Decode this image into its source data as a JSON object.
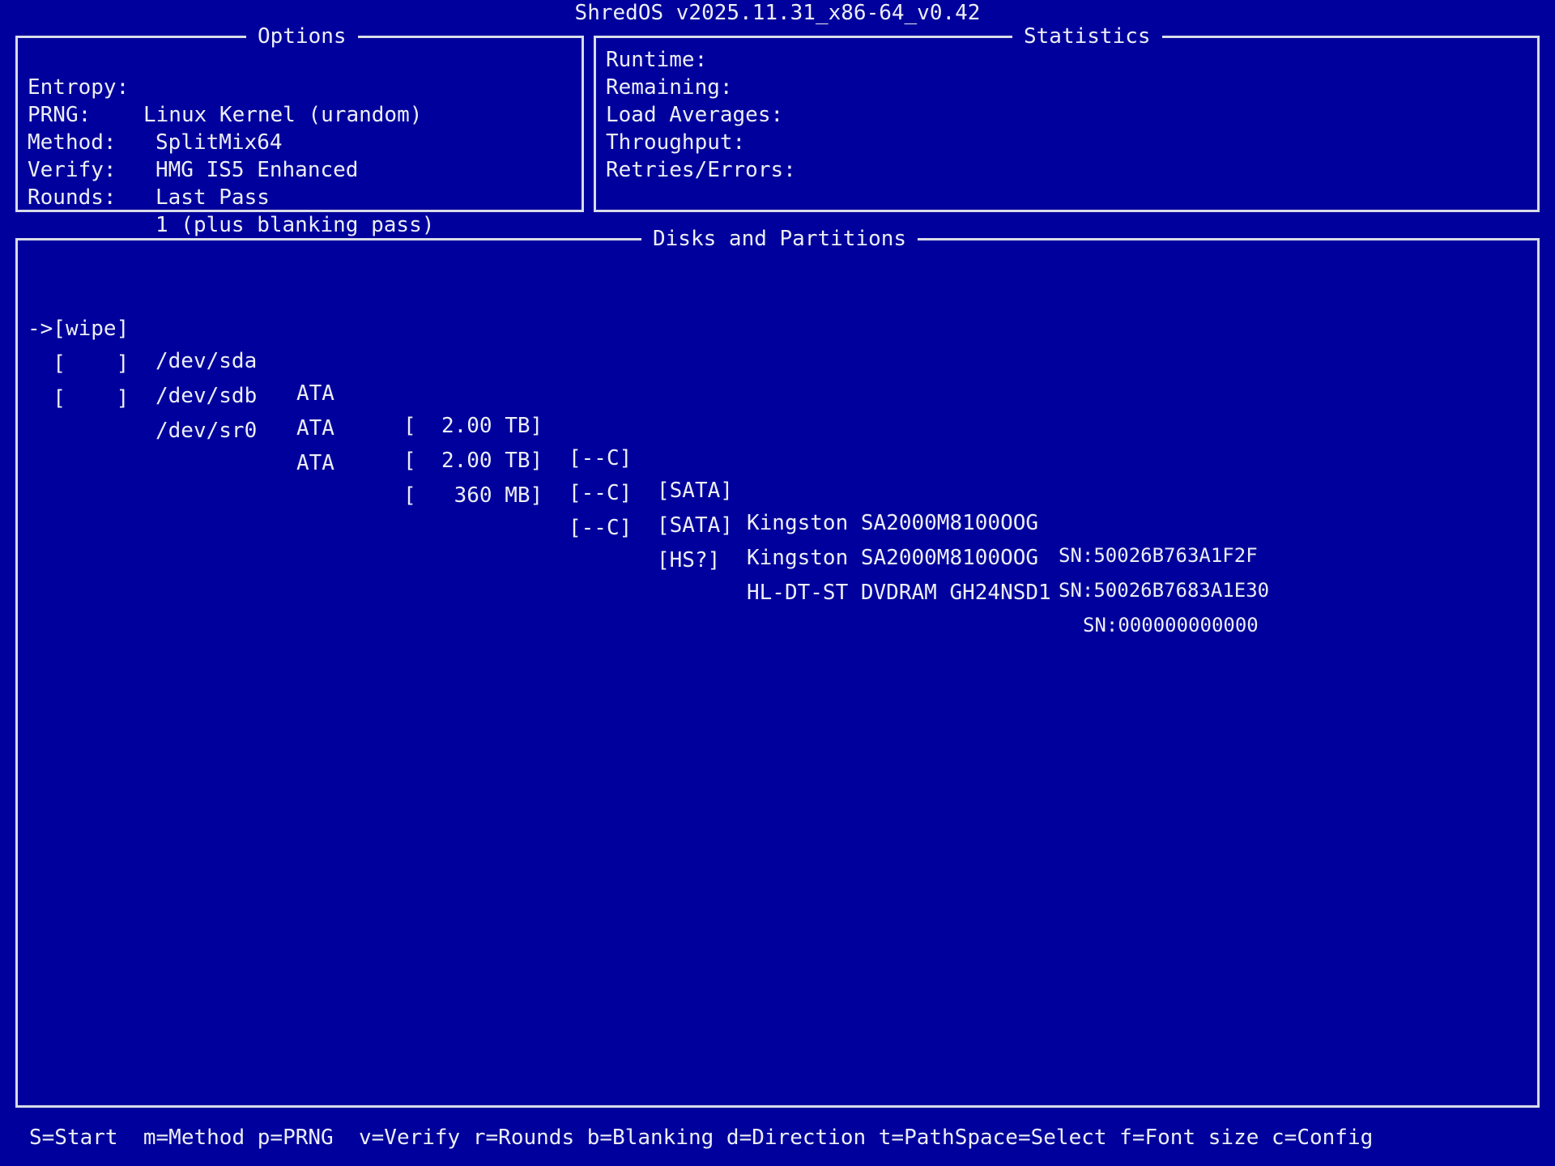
{
  "app_title": "ShredOS v2025.11.31_x86-64_v0.42",
  "options": {
    "title": "Options",
    "rows": [
      {
        "label": "Entropy:",
        "value": "Linux Kernel (urandom)"
      },
      {
        "label": "PRNG:",
        "value": "SplitMix64"
      },
      {
        "label": "Method:",
        "value": "HMG IS5 Enhanced"
      },
      {
        "label": "Verify:",
        "value": "Last Pass"
      },
      {
        "label": "Rounds:",
        "value": "1 (plus blanking pass)"
      }
    ]
  },
  "statistics": {
    "title": "Statistics",
    "rows": [
      "Runtime:",
      "Remaining:",
      "Load Averages:",
      "Throughput:",
      "Retries/Errors:"
    ]
  },
  "disks": {
    "title": "Disks and Partitions",
    "rows": [
      {
        "selector": "->[wipe]",
        "device": "/dev/sda",
        "bus": "ATA",
        "size": "[  2.00 TB]",
        "flags": "[--C]",
        "iface": "[SATA]",
        "model": "Kingston SA2000M8100OOG",
        "serial": "SN:50026B763A1F2F"
      },
      {
        "selector": "  [    ]",
        "device": "/dev/sdb",
        "bus": "ATA",
        "size": "[  2.00 TB]",
        "flags": "[--C]",
        "iface": "[SATA]",
        "model": "Kingston SA2000M8100OOG",
        "serial": "SN:50026B7683A1E30"
      },
      {
        "selector": "  [    ]",
        "device": "/dev/sr0",
        "bus": "ATA",
        "size": "[   360 MB]",
        "flags": "[--C]",
        "iface": "[HS?]",
        "model": "HL-DT-ST DVDRAM GH24NSD1",
        "serial": "SN:000000000000"
      }
    ]
  },
  "footer": {
    "keys": "S=Start  m=Method p=PRNG  v=Verify r=Rounds b=Blanking d=Direction t=PathSpace=Select f=Font size c=Config"
  }
}
